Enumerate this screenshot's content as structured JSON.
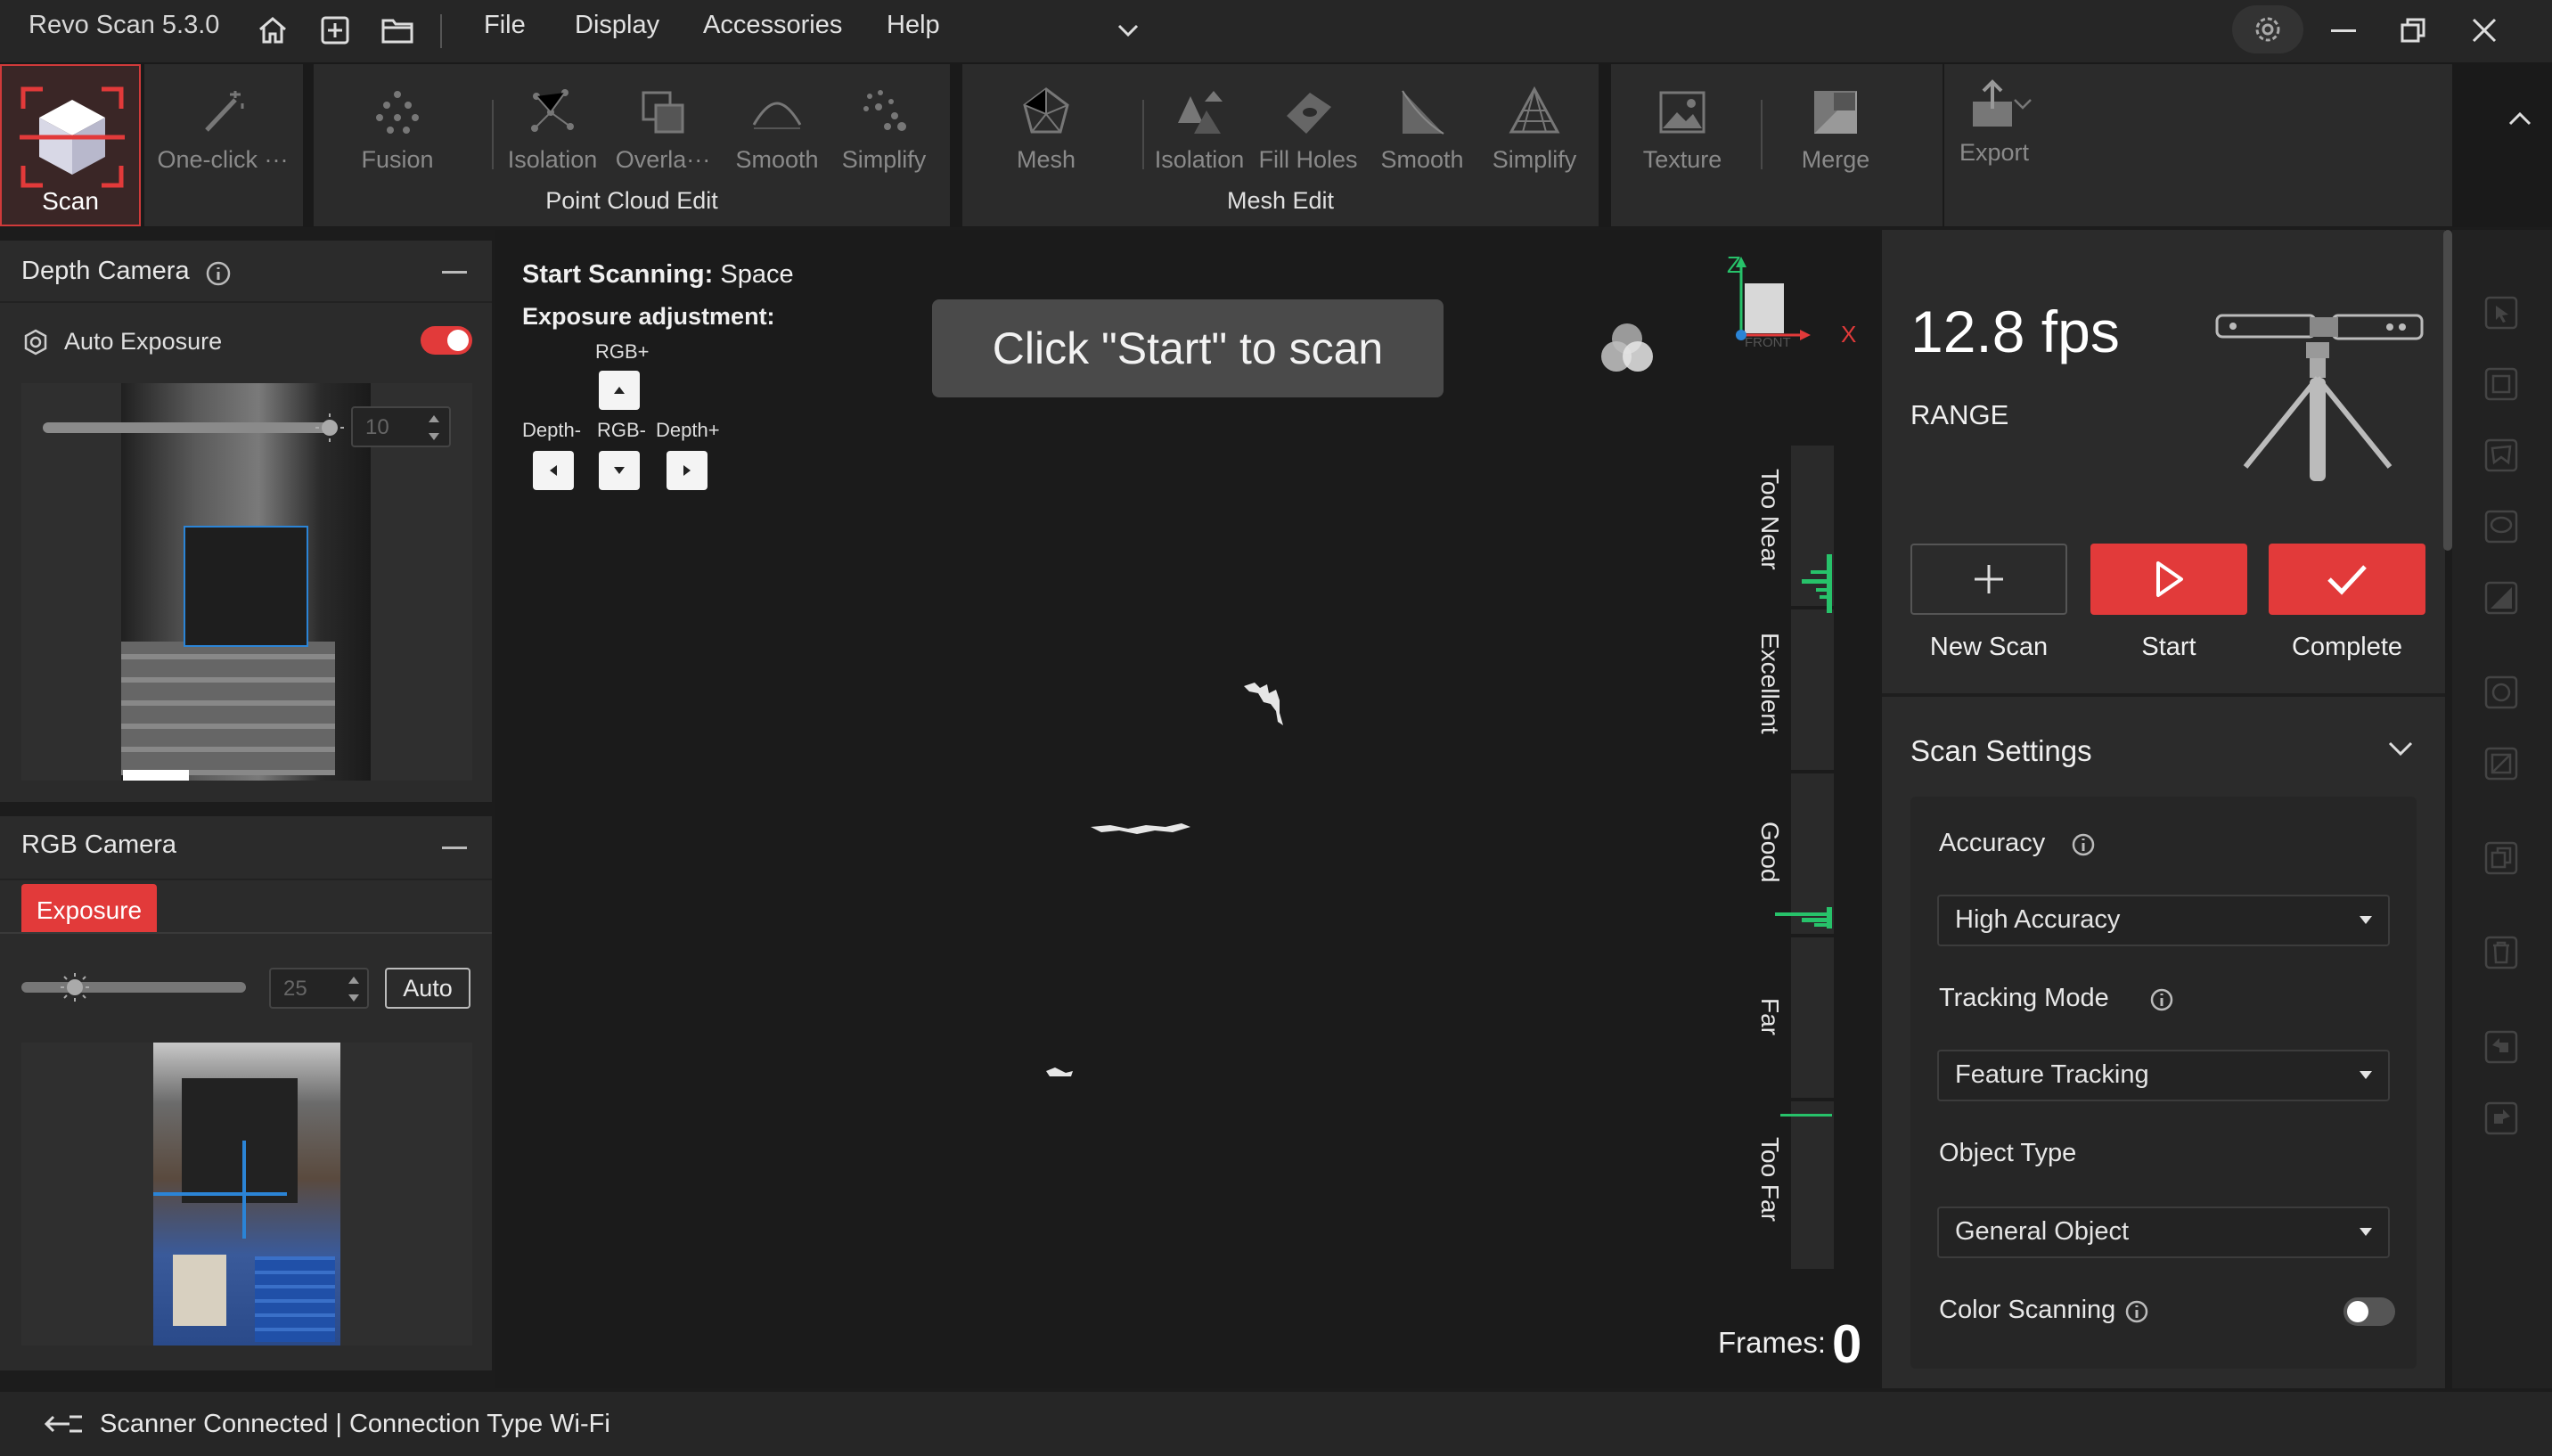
{
  "app": {
    "title": "Revo Scan 5.3.0",
    "menu": [
      "File",
      "Display",
      "Accessories",
      "Help"
    ]
  },
  "ribbon": {
    "scan": "Scan",
    "one_click": "One-click ···",
    "fusion": "Fusion",
    "pc_isolation": "Isolation",
    "pc_overlap": "Overla···",
    "pc_smooth": "Smooth",
    "pc_simplify": "Simplify",
    "point_cloud_edit": "Point Cloud Edit",
    "mesh": "Mesh",
    "mesh_isolation": "Isolation",
    "fill_holes": "Fill Holes",
    "mesh_smooth": "Smooth",
    "mesh_simplify": "Simplify",
    "mesh_edit": "Mesh Edit",
    "texture": "Texture",
    "merge": "Merge",
    "export": "Export"
  },
  "depth_camera": {
    "title": "Depth Camera",
    "auto_exposure": "Auto Exposure",
    "auto_exposure_on": true,
    "exposure_value": "10",
    "slider_fraction": 0.98
  },
  "rgb_camera": {
    "title": "RGB Camera",
    "exposure_tab": "Exposure",
    "exposure_value": "25",
    "auto_label": "Auto",
    "slider_fraction": 0.25
  },
  "viewport": {
    "start_label": "Start Scanning:",
    "start_key": "Space",
    "exposure_adjustment": "Exposure adjustment:",
    "rgb_plus": "RGB+",
    "depth_minus": "Depth-",
    "rgb_minus": "RGB-",
    "depth_plus": "Depth+",
    "hint": "Click \"Start\" to scan",
    "axis_z": "Z",
    "axis_x": "X",
    "cube_face": "FRONT",
    "distance_labels": [
      "Too Near",
      "Excellent",
      "Good",
      "Far",
      "Too Far"
    ],
    "frames_label": "Frames:",
    "frames_value": "0"
  },
  "right_panel": {
    "fps": "12.8 fps",
    "range": "RANGE",
    "new_scan": "New Scan",
    "start": "Start",
    "complete": "Complete",
    "scan_settings": "Scan Settings",
    "accuracy_label": "Accuracy",
    "accuracy_value": "High Accuracy",
    "tracking_label": "Tracking Mode",
    "tracking_value": "Feature Tracking",
    "object_label": "Object Type",
    "object_value": "General Object",
    "color_scanning": "Color Scanning",
    "color_scanning_on": false
  },
  "status": {
    "text": "Scanner Connected | Connection Type Wi-Fi"
  },
  "colors": {
    "accent_red": "#e23a3a",
    "green": "#27c26a",
    "blue": "#2b84d6"
  }
}
